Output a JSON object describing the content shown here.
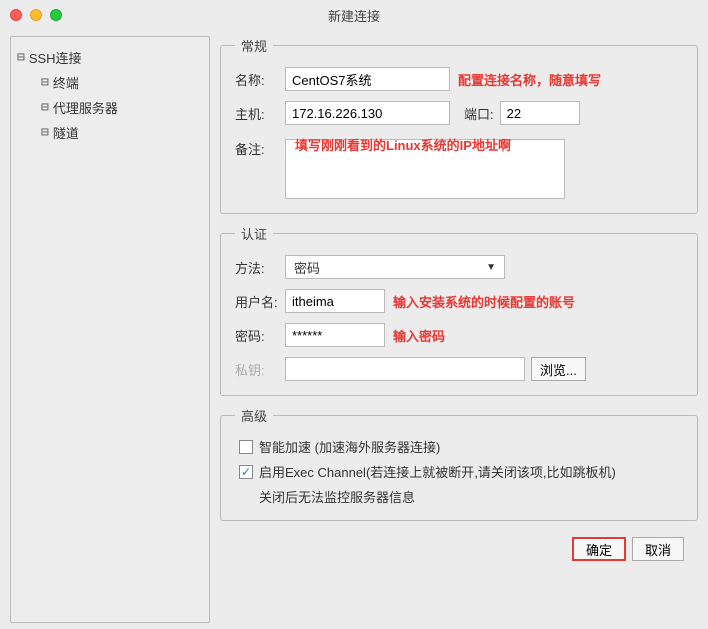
{
  "title": "新建连接",
  "sidebar": {
    "root": "SSH连接",
    "items": [
      "终端",
      "代理服务器",
      "隧道"
    ]
  },
  "general": {
    "legend": "常规",
    "name_label": "名称:",
    "name_value": "CentOS7系统",
    "name_annot": "配置连接名称，随意填写",
    "host_label": "主机:",
    "host_value": "172.16.226.130",
    "port_label": "端口:",
    "port_value": "22",
    "memo_label": "备注:",
    "memo_annot": "填写刚刚看到的Linux系统的IP地址啊"
  },
  "auth": {
    "legend": "认证",
    "method_label": "方法:",
    "method_value": "密码",
    "user_label": "用户名:",
    "user_value": "itheima",
    "user_annot": "输入安装系统的时候配置的账号",
    "pass_label": "密码:",
    "pass_value": "******",
    "pass_annot": "输入密码",
    "pk_label": "私钥:",
    "browse": "浏览..."
  },
  "advanced": {
    "legend": "高级",
    "accel": "智能加速 (加速海外服务器连接)",
    "exec": "启用Exec Channel(若连接上就被断开,请关闭该项,比如跳板机)",
    "exec_note": "关闭后无法监控服务器信息"
  },
  "footer": {
    "ok": "确定",
    "cancel": "取消"
  }
}
